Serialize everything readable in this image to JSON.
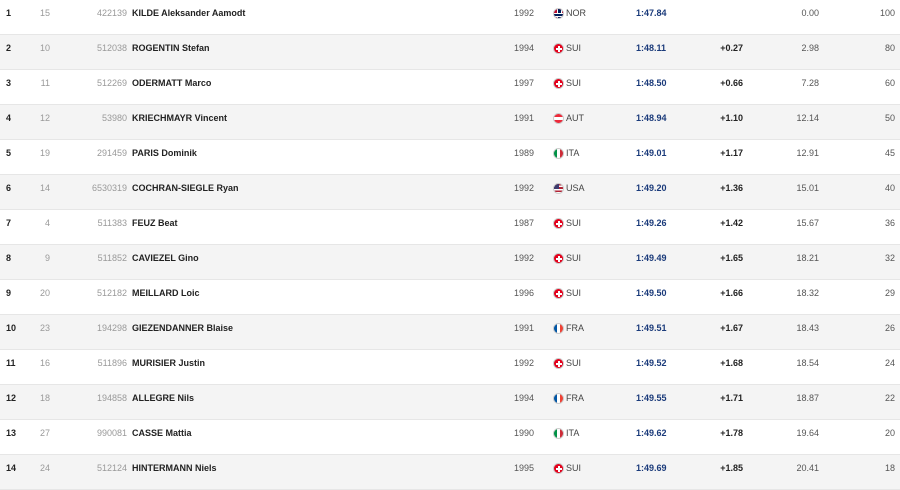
{
  "colors": {
    "row_alt": "#f4f4f4",
    "time_text": "#1a3a7a",
    "divider": "#e6e6e6"
  },
  "rows": [
    {
      "rank": "1",
      "bib": "15",
      "code": "422139",
      "name": "KILDE Aleksander Aamodt",
      "year": "1992",
      "nation": "NOR",
      "time": "1:47.84",
      "diff": "",
      "points": "0.00",
      "cup": "100"
    },
    {
      "rank": "2",
      "bib": "10",
      "code": "512038",
      "name": "ROGENTIN Stefan",
      "year": "1994",
      "nation": "SUI",
      "time": "1:48.11",
      "diff": "+0.27",
      "points": "2.98",
      "cup": "80"
    },
    {
      "rank": "3",
      "bib": "11",
      "code": "512269",
      "name": "ODERMATT Marco",
      "year": "1997",
      "nation": "SUI",
      "time": "1:48.50",
      "diff": "+0.66",
      "points": "7.28",
      "cup": "60"
    },
    {
      "rank": "4",
      "bib": "12",
      "code": "53980",
      "name": "KRIECHMAYR Vincent",
      "year": "1991",
      "nation": "AUT",
      "time": "1:48.94",
      "diff": "+1.10",
      "points": "12.14",
      "cup": "50"
    },
    {
      "rank": "5",
      "bib": "19",
      "code": "291459",
      "name": "PARIS Dominik",
      "year": "1989",
      "nation": "ITA",
      "time": "1:49.01",
      "diff": "+1.17",
      "points": "12.91",
      "cup": "45"
    },
    {
      "rank": "6",
      "bib": "14",
      "code": "6530319",
      "name": "COCHRAN-SIEGLE Ryan",
      "year": "1992",
      "nation": "USA",
      "time": "1:49.20",
      "diff": "+1.36",
      "points": "15.01",
      "cup": "40"
    },
    {
      "rank": "7",
      "bib": "4",
      "code": "511383",
      "name": "FEUZ Beat",
      "year": "1987",
      "nation": "SUI",
      "time": "1:49.26",
      "diff": "+1.42",
      "points": "15.67",
      "cup": "36"
    },
    {
      "rank": "8",
      "bib": "9",
      "code": "511852",
      "name": "CAVIEZEL Gino",
      "year": "1992",
      "nation": "SUI",
      "time": "1:49.49",
      "diff": "+1.65",
      "points": "18.21",
      "cup": "32"
    },
    {
      "rank": "9",
      "bib": "20",
      "code": "512182",
      "name": "MEILLARD Loic",
      "year": "1996",
      "nation": "SUI",
      "time": "1:49.50",
      "diff": "+1.66",
      "points": "18.32",
      "cup": "29"
    },
    {
      "rank": "10",
      "bib": "23",
      "code": "194298",
      "name": "GIEZENDANNER Blaise",
      "year": "1991",
      "nation": "FRA",
      "time": "1:49.51",
      "diff": "+1.67",
      "points": "18.43",
      "cup": "26"
    },
    {
      "rank": "11",
      "bib": "16",
      "code": "511896",
      "name": "MURISIER Justin",
      "year": "1992",
      "nation": "SUI",
      "time": "1:49.52",
      "diff": "+1.68",
      "points": "18.54",
      "cup": "24"
    },
    {
      "rank": "12",
      "bib": "18",
      "code": "194858",
      "name": "ALLEGRE Nils",
      "year": "1994",
      "nation": "FRA",
      "time": "1:49.55",
      "diff": "+1.71",
      "points": "18.87",
      "cup": "22"
    },
    {
      "rank": "13",
      "bib": "27",
      "code": "990081",
      "name": "CASSE Mattia",
      "year": "1990",
      "nation": "ITA",
      "time": "1:49.62",
      "diff": "+1.78",
      "points": "19.64",
      "cup": "20"
    },
    {
      "rank": "14",
      "bib": "24",
      "code": "512124",
      "name": "HINTERMANN Niels",
      "year": "1995",
      "nation": "SUI",
      "time": "1:49.69",
      "diff": "+1.85",
      "points": "20.41",
      "cup": "18"
    }
  ]
}
